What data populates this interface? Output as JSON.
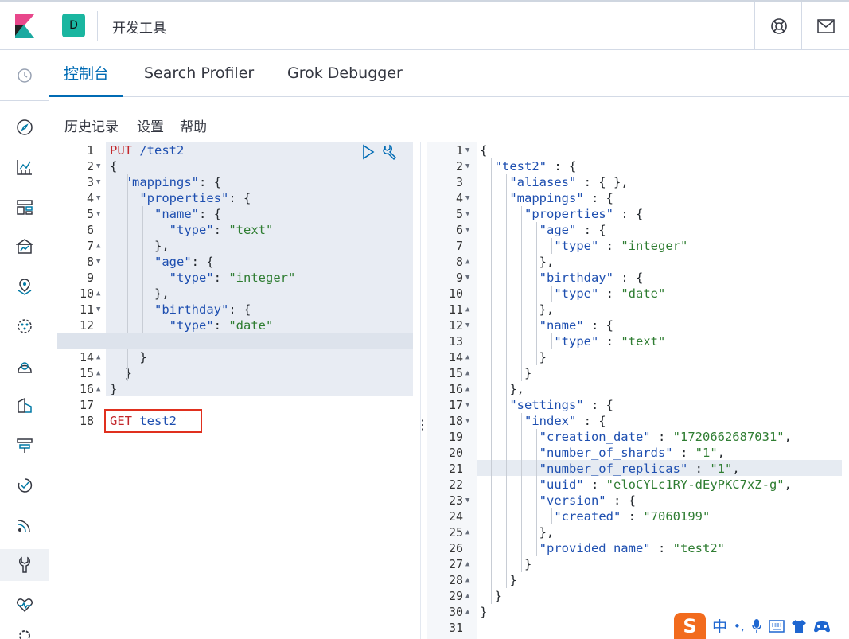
{
  "header": {
    "space_initial": "D",
    "app_title": "开发工具"
  },
  "tabs": [
    {
      "label": "控制台",
      "active": true
    },
    {
      "label": "Search Profiler",
      "active": false
    },
    {
      "label": "Grok Debugger",
      "active": false
    }
  ],
  "toolbar": {
    "history": "历史记录",
    "settings": "设置",
    "help": "帮助"
  },
  "request_editor": {
    "lines": [
      "PUT /test2",
      "{",
      "  \"mappings\": {",
      "    \"properties\": {",
      "      \"name\": {",
      "        \"type\": \"text\"",
      "      },",
      "      \"age\": {",
      "        \"type\": \"integer\"",
      "      },",
      "      \"birthday\": {",
      "        \"type\": \"date\"",
      "      }",
      "    }",
      "  }",
      "}",
      "",
      "GET test2"
    ],
    "fold_lines": [
      2,
      3,
      4,
      5,
      7,
      8,
      10,
      11,
      13,
      14,
      15,
      16
    ],
    "fold_open": [
      2,
      3,
      4,
      5,
      8,
      11
    ],
    "active_line": 13,
    "highlighted_request": "GET test2"
  },
  "response_viewer": {
    "lines": [
      "{",
      "  \"test2\" : {",
      "    \"aliases\" : { },",
      "    \"mappings\" : {",
      "      \"properties\" : {",
      "        \"age\" : {",
      "          \"type\" : \"integer\"",
      "        },",
      "        \"birthday\" : {",
      "          \"type\" : \"date\"",
      "        },",
      "        \"name\" : {",
      "          \"type\" : \"text\"",
      "        }",
      "      }",
      "    },",
      "    \"settings\" : {",
      "      \"index\" : {",
      "        \"creation_date\" : \"1720662687031\",",
      "        \"number_of_shards\" : \"1\",",
      "        \"number_of_replicas\" : \"1\",",
      "        \"uuid\" : \"eloCYLc1RY-dEyPKC7xZ-g\",",
      "        \"version\" : {",
      "          \"created\" : \"7060199\"",
      "        },",
      "        \"provided_name\" : \"test2\"",
      "      }",
      "    }",
      "  }",
      "}",
      ""
    ],
    "fold_lines": [
      1,
      2,
      4,
      5,
      6,
      8,
      9,
      11,
      12,
      14,
      15,
      16,
      17,
      18,
      23,
      25,
      27,
      28,
      29,
      30
    ],
    "fold_open": [
      1,
      2,
      4,
      5,
      6,
      9,
      12,
      17,
      18,
      23
    ],
    "active_line": 21
  },
  "ime_bar": {
    "logo": "S",
    "mode": "中",
    "punct": "•,"
  },
  "colors": {
    "accent": "#006bb4",
    "string": "#2f7d32",
    "method": "#c3272b",
    "highlight_box": "#e0301e"
  }
}
